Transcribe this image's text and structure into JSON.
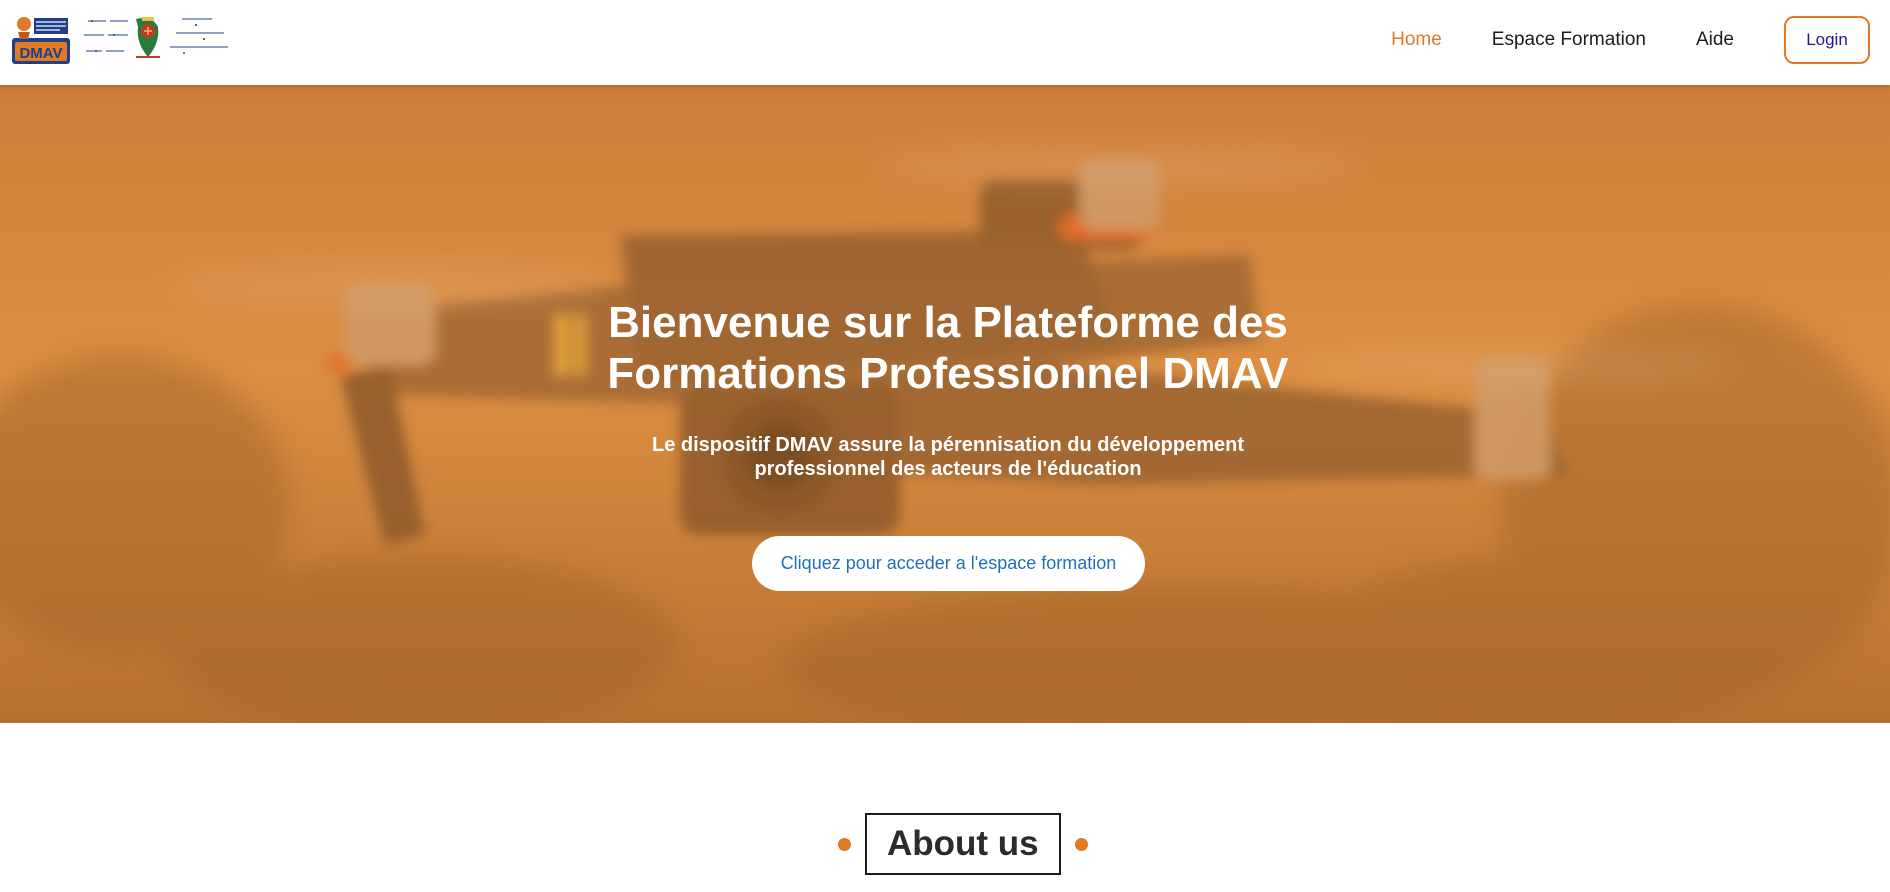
{
  "header": {
    "logo_dmav": "DMAV",
    "nav": {
      "home": "Home",
      "espace_formation": "Espace Formation",
      "aide": "Aide",
      "login": "Login"
    }
  },
  "hero": {
    "title": "Bienvenue sur la Plateforme des Formations Professionnel DMAV",
    "subtitle": "Le dispositif DMAV assure la pérennisation du développement professionnel des acteurs de l'éducation",
    "cta": "Cliquez pour acceder a l'espace formation",
    "background": "drone-photo"
  },
  "about": {
    "heading": "About us"
  },
  "colors": {
    "accent": "#e07a26",
    "login_text": "#1a1a9a",
    "cta_text": "#1f6fbf",
    "hero_overlay": "#d98a3a"
  }
}
